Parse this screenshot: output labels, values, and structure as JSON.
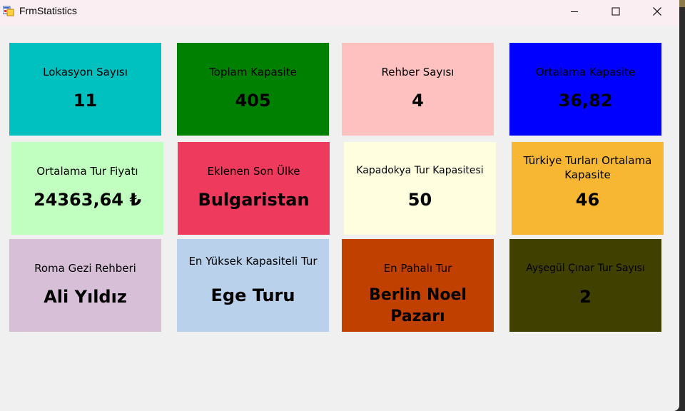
{
  "window": {
    "title": "FrmStatistics",
    "colors": {
      "background": "#f0f0f0",
      "titlebar": "#faeef3"
    }
  },
  "tiles": [
    {
      "label": "Lokasyon Sayısı",
      "value": "11",
      "bg": "#00c0c0",
      "label_color": "#000000",
      "value_color": "#000000"
    },
    {
      "label": "Toplam Kapasite",
      "value": "405",
      "bg": "#008000",
      "label_color": "#000000",
      "value_color": "#000000"
    },
    {
      "label": "Rehber Sayısı",
      "value": "4",
      "bg": "#ffc0c0",
      "label_color": "#000000",
      "value_color": "#000000"
    },
    {
      "label": "Ortalama Kapasite",
      "value": "36,82",
      "bg": "#0000ff",
      "label_color": "#000000",
      "value_color": "#000000"
    },
    {
      "label": "Ortalama Tur Fiyatı",
      "value": "24363,64 ₺",
      "bg": "#c0ffc0",
      "label_color": "#000000",
      "value_color": "#000000"
    },
    {
      "label": "Eklenen Son Ülke",
      "value": "Bulgaristan",
      "bg": "#ee3a5d",
      "label_color": "#000000",
      "value_color": "#000000"
    },
    {
      "label": "Kapadokya Tur Kapasitesi",
      "value": "50",
      "bg": "#ffffe0",
      "label_color": "#000000",
      "value_color": "#000000"
    },
    {
      "label": "Türkiye Turları Ortalama Kapasite",
      "value": "46",
      "bg": "#f7b733",
      "label_color": "#000000",
      "value_color": "#000000"
    },
    {
      "label": "Roma Gezi Rehberi",
      "value": "Ali Yıldız",
      "bg": "#d8bfd8",
      "label_color": "#000000",
      "value_color": "#000000"
    },
    {
      "label": "En Yüksek Kapasiteli Tur",
      "value": "Ege Turu",
      "bg": "#b9d1ea",
      "label_color": "#000000",
      "value_color": "#000000"
    },
    {
      "label": "En Pahalı Tur",
      "value": "Berlin Noel Pazarı",
      "bg": "#c04000",
      "label_color": "#000000",
      "value_color": "#000000"
    },
    {
      "label": "Ayşegül Çınar Tur Sayısı",
      "value": "2",
      "bg": "#404000",
      "label_color": "#000000",
      "value_color": "#000000"
    }
  ]
}
